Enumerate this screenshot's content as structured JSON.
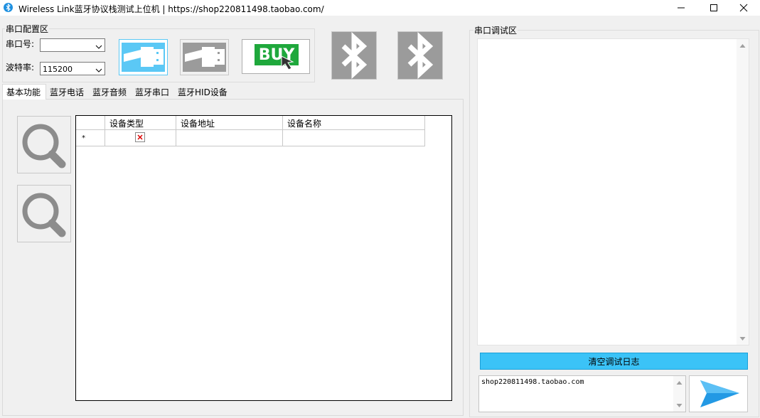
{
  "window": {
    "title": "Wireless Link蓝牙协议栈测试上位机 | https://shop220811498.taobao.com/"
  },
  "serial_config": {
    "group_title": "串口配置区",
    "port_label": "串口号:",
    "port_value": "",
    "baud_label": "波特率:",
    "baud_value": "115200"
  },
  "buttons": {
    "buy_label": "BUY"
  },
  "tabs": [
    {
      "label": "基本功能"
    },
    {
      "label": "蓝牙电话"
    },
    {
      "label": "蓝牙音频"
    },
    {
      "label": "蓝牙串口"
    },
    {
      "label": "蓝牙HID设备"
    }
  ],
  "grid": {
    "columns": [
      "设备类型",
      "设备地址",
      "设备名称"
    ],
    "new_row_marker": "*"
  },
  "debug": {
    "group_title": "串口调试区",
    "clear_button": "清空调试日志",
    "send_text": "shop220811498.taobao.com"
  },
  "colors": {
    "accent_blue": "#3bc3f7",
    "usb_active": "#5bc8f5",
    "usb_inactive": "#9b9b9b",
    "buy_green": "#1fa83c",
    "send_arrow": "#2399e4"
  }
}
